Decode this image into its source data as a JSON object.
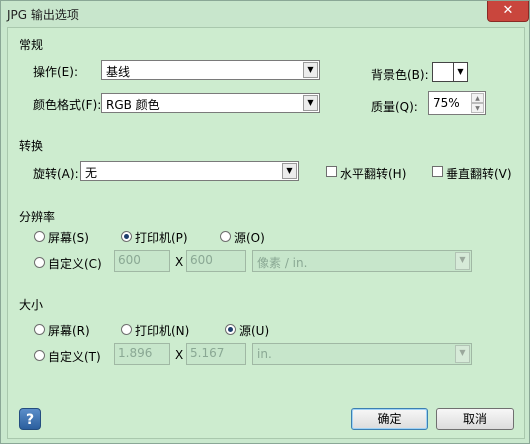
{
  "window": {
    "title": "JPG 输出选项",
    "close": "✕"
  },
  "general": {
    "section": "常规",
    "operation": {
      "label": "操作(E):",
      "value": "基线"
    },
    "color_format": {
      "label": "颜色格式(F):",
      "value": "RGB 颜色"
    },
    "background": {
      "label": "背景色(B):"
    },
    "quality": {
      "label": "质量(Q):",
      "value": "75%"
    }
  },
  "transform": {
    "section": "转换",
    "rotate": {
      "label": "旋转(A):",
      "value": "无"
    },
    "flip_h": "水平翻转(H)",
    "flip_v": "垂直翻转(V)"
  },
  "resolution": {
    "section": "分辨率",
    "screen": "屏幕(S)",
    "printer": "打印机(P)",
    "source": "源(O)",
    "custom": "自定义(C)",
    "w": "600",
    "x": "X",
    "h": "600",
    "unit": "像素 / in."
  },
  "size": {
    "section": "大小",
    "screen": "屏幕(R)",
    "printer": "打印机(N)",
    "source": "源(U)",
    "custom": "自定义(T)",
    "w": "1.896",
    "x": "X",
    "h": "5.167",
    "unit": "in."
  },
  "buttons": {
    "help": "?",
    "ok": "确定",
    "cancel": "取消"
  },
  "icons": {
    "dropdown": "chevron-down-icon",
    "help": "help-icon",
    "close": "close-icon"
  }
}
